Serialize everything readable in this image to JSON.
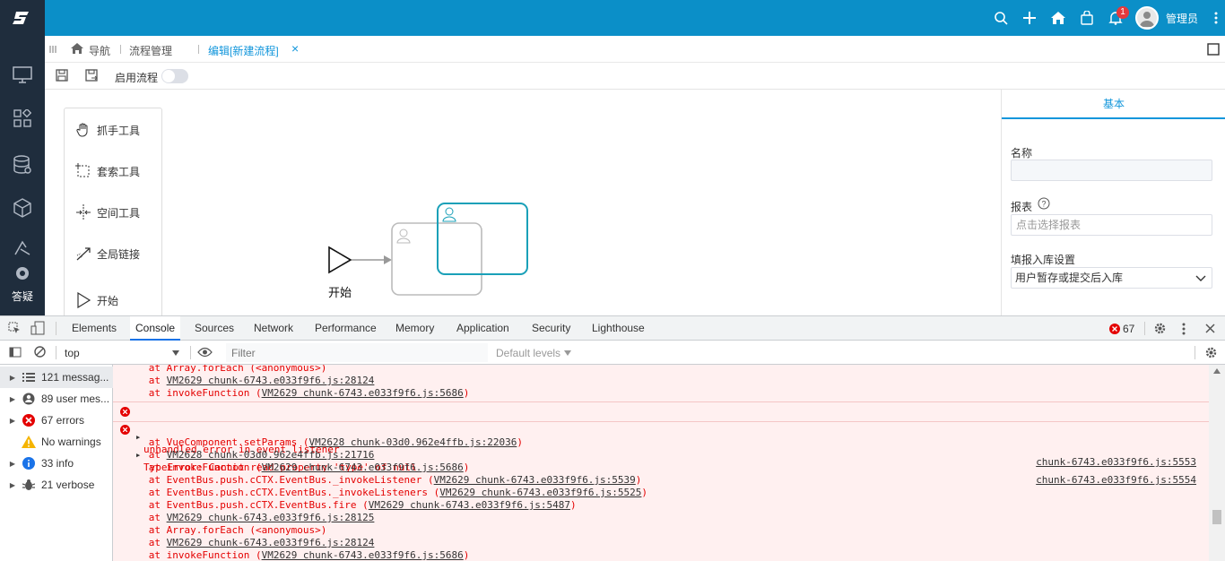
{
  "topbar": {
    "username": "管理员",
    "notification_count": "1",
    "colors": {
      "bar": "#0b8fc8",
      "sidebar": "#1f2d3d"
    }
  },
  "sidebar": {
    "items": [
      {
        "icon": "monitor-icon"
      },
      {
        "icon": "apps-icon"
      },
      {
        "icon": "database-icon"
      },
      {
        "icon": "cube-icon"
      },
      {
        "icon": "answer-icon",
        "label": "答疑"
      }
    ]
  },
  "tabbar": {
    "home": "导航",
    "tab1": "流程管理",
    "tab2": "编辑[新建流程]",
    "close": "×"
  },
  "toolbar": {
    "enable_label": "启用流程"
  },
  "palette": {
    "items": [
      {
        "label": "抓手工具",
        "icon": "hand-icon"
      },
      {
        "label": "套索工具",
        "icon": "lasso-icon"
      },
      {
        "label": "空间工具",
        "icon": "space-icon"
      },
      {
        "label": "全局链接",
        "icon": "link-icon"
      },
      {
        "label": "开始",
        "icon": "start-icon"
      }
    ]
  },
  "diagram": {
    "start_label": "开始"
  },
  "rightpanel": {
    "tab": "基本",
    "name_label": "名称",
    "name_value": "",
    "report_label": "报表",
    "report_placeholder": "点击选择报表",
    "storage_label": "填报入库设置",
    "storage_value": "用户暂存或提交后入库"
  },
  "devtools": {
    "tabs": [
      "Elements",
      "Console",
      "Sources",
      "Network",
      "Performance",
      "Memory",
      "Application",
      "Security",
      "Lighthouse"
    ],
    "active_tab": "Console",
    "error_count": "67",
    "context": "top",
    "filter_placeholder": "Filter",
    "levels": "Default levels",
    "sidebar": [
      {
        "label": "121 messag...",
        "icon": "list-icon"
      },
      {
        "label": "89 user mes...",
        "icon": "user-icon"
      },
      {
        "label": "67 errors",
        "icon": "error-icon"
      },
      {
        "label": "No warnings",
        "icon": "warning-icon"
      },
      {
        "label": "33 info",
        "icon": "info-icon"
      },
      {
        "label": "21 verbose",
        "icon": "bug-icon"
      }
    ],
    "log": {
      "top_lines": [
        {
          "pre": "      at Array.forEach (<anonymous>)",
          "link": "",
          "post": ""
        },
        {
          "pre": "      at ",
          "link": "VM2629 chunk-6743.e033f9f6.js:28124",
          "post": ""
        },
        {
          "pre": "      at invokeFunction (",
          "link": "VM2629 chunk-6743.e033f9f6.js:5686",
          "post": ")"
        }
      ],
      "error1": {
        "msg": "unhandled error in event listener",
        "src": "chunk-6743.e033f9f6.js:5553"
      },
      "error2": {
        "msg": "TypeError: Cannot read property 'type' of null",
        "src": "chunk-6743.e033f9f6.js:5554"
      },
      "stack": [
        {
          "pre": "      at VueComponent.setParams (",
          "link": "VM2628 chunk-03d0.962e4ffb.js:22036",
          "post": ")"
        },
        {
          "pre": "      at ",
          "link": "VM2628 chunk-03d0.962e4ffb.js:21716",
          "post": ""
        },
        {
          "pre": "      at invokeFunction (",
          "link": "VM2629 chunk-6743.e033f9f6.js:5686",
          "post": ")"
        },
        {
          "pre": "      at EventBus.push.cCTX.EventBus._invokeListener (",
          "link": "VM2629 chunk-6743.e033f9f6.js:5539",
          "post": ")"
        },
        {
          "pre": "      at EventBus.push.cCTX.EventBus._invokeListeners (",
          "link": "VM2629 chunk-6743.e033f9f6.js:5525",
          "post": ")"
        },
        {
          "pre": "      at EventBus.push.cCTX.EventBus.fire (",
          "link": "VM2629 chunk-6743.e033f9f6.js:5487",
          "post": ")"
        },
        {
          "pre": "      at ",
          "link": "VM2629 chunk-6743.e033f9f6.js:28125",
          "post": ""
        },
        {
          "pre": "      at Array.forEach (<anonymous>)",
          "link": "",
          "post": ""
        },
        {
          "pre": "      at ",
          "link": "VM2629 chunk-6743.e033f9f6.js:28124",
          "post": ""
        },
        {
          "pre": "      at invokeFunction (",
          "link": "VM2629 chunk-6743.e033f9f6.js:5686",
          "post": ")"
        }
      ]
    }
  }
}
